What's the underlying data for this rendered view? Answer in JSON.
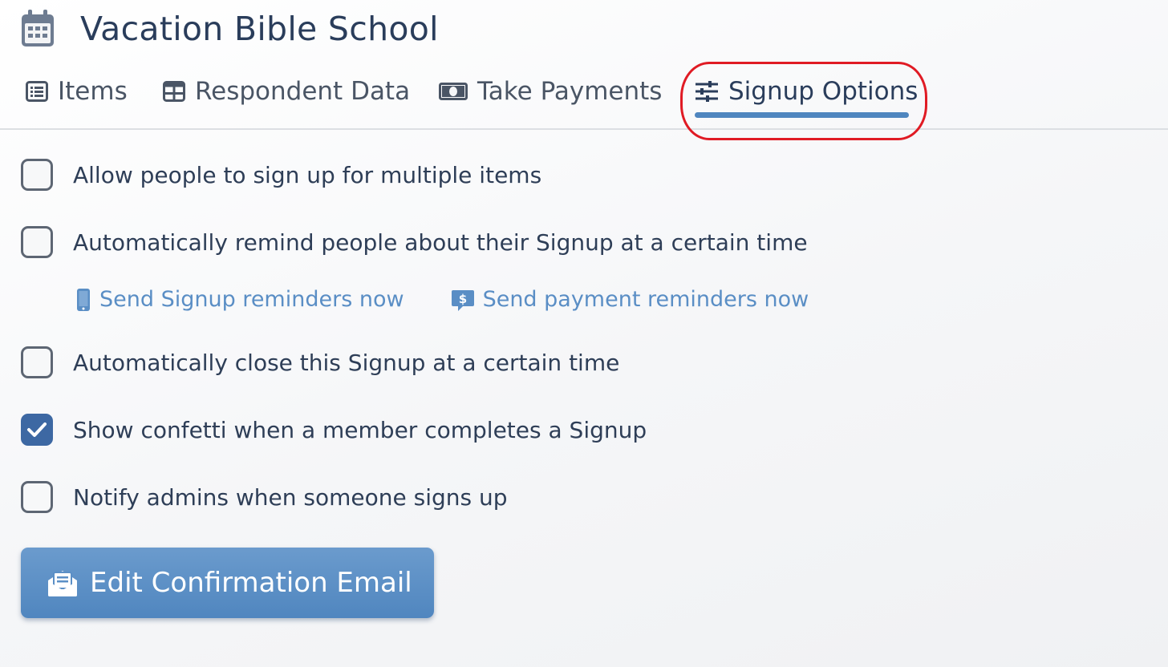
{
  "header": {
    "title": "Vacation Bible School",
    "icon": "calendar-icon"
  },
  "tabs": [
    {
      "label": "Items",
      "icon": "list-icon",
      "active": false
    },
    {
      "label": "Respondent Data",
      "icon": "table-icon",
      "active": false
    },
    {
      "label": "Take Payments",
      "icon": "money-icon",
      "active": false
    },
    {
      "label": "Signup Options",
      "icon": "sliders-icon",
      "active": true
    }
  ],
  "options": [
    {
      "label": "Allow people to sign up for multiple items",
      "checked": false
    },
    {
      "label": "Automatically remind people about their Signup at a certain time",
      "checked": false
    },
    {
      "label": "Automatically close this Signup at a certain time",
      "checked": false
    },
    {
      "label": "Show confetti when a member completes a Signup",
      "checked": true
    },
    {
      "label": "Notify admins when someone signs up",
      "checked": false
    }
  ],
  "reminders": {
    "signup_label": "Send Signup reminders now",
    "signup_icon": "mobile-phone-icon",
    "payment_label": "Send payment reminders now",
    "payment_icon": "dollar-message-icon"
  },
  "button": {
    "label": "Edit Confirmation Email",
    "icon": "envelope-open-icon"
  },
  "colors": {
    "accent": "#4f86bf",
    "link": "#5a8ec5",
    "checked": "#3d68a3",
    "highlight": "#e01b24",
    "text": "#2e3e57"
  }
}
